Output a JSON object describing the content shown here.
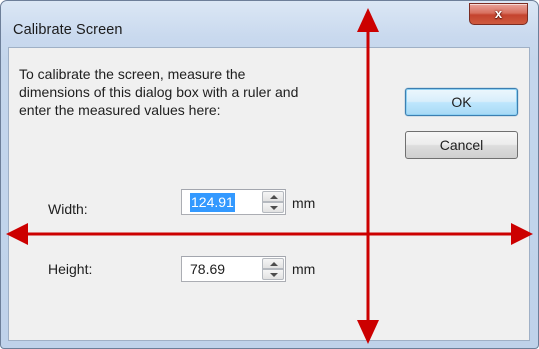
{
  "window": {
    "title": "Calibrate Screen",
    "close_icon": "close-icon",
    "close_glyph": "x"
  },
  "instructions": {
    "line1": "To calibrate the screen, measure the",
    "line2": "dimensions of this dialog box with a ruler and",
    "line3": "enter the measured values here:"
  },
  "buttons": {
    "ok_label": "OK",
    "cancel_label": "Cancel"
  },
  "fields": {
    "width": {
      "label": "Width:",
      "value": "124.91",
      "unit": "mm",
      "selected": true
    },
    "height": {
      "label": "Height:",
      "value": "78.69",
      "unit": "mm"
    }
  },
  "colors": {
    "measurement_arrows": "#cc0000",
    "selection": "#3399ff",
    "close_button": "#c4432e"
  },
  "icons": {
    "spin_up": "triangle-up",
    "spin_down": "triangle-down",
    "measure_arrows": "double-headed-arrow"
  }
}
